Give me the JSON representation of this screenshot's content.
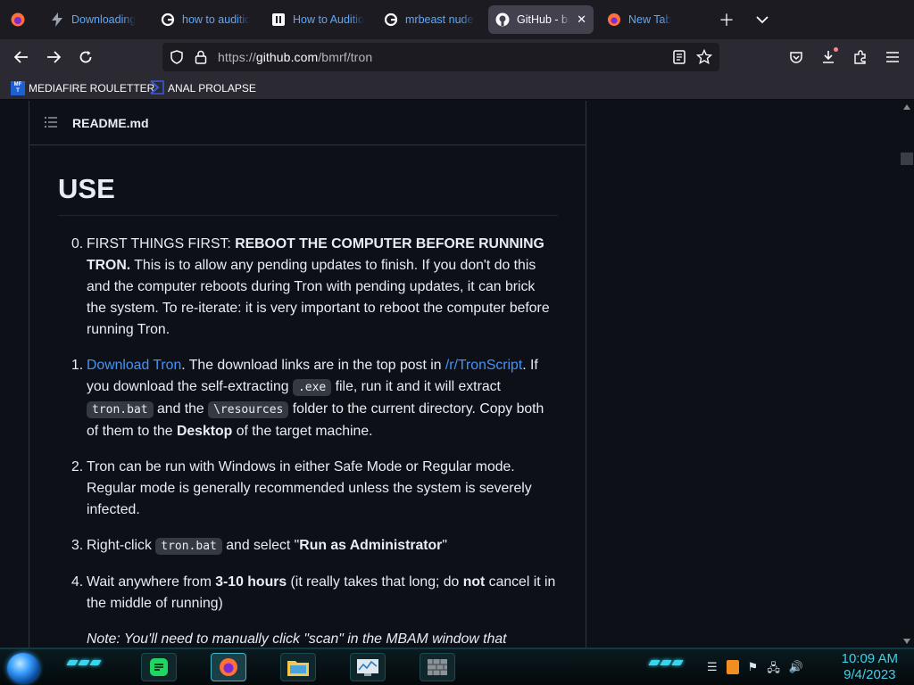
{
  "tabs": [
    {
      "label": "Downloading C",
      "icon": "bolt-icon"
    },
    {
      "label": "how to audition",
      "icon": "google-icon"
    },
    {
      "label": "How to Auditio",
      "icon": "site-icon"
    },
    {
      "label": "mrbeast nudes",
      "icon": "google-icon"
    },
    {
      "label": "GitHub - bmrf",
      "icon": "github-icon",
      "active": true
    },
    {
      "label": "New Tab",
      "icon": "firefox-icon"
    }
  ],
  "url": {
    "scheme": "https://",
    "host": "github.com",
    "path": "/bmrf/tron"
  },
  "bookmarks": [
    {
      "label": "MEDIAFIRE ROULETTER",
      "badge": "MF\nT"
    },
    {
      "label": "ANAL PROLAPSE"
    }
  ],
  "readme": {
    "file_title": "README.md",
    "heading": "USE",
    "steps": [
      {
        "num": "0.",
        "lead": "FIRST THINGS FIRST: ",
        "bold": "REBOOT THE COMPUTER BEFORE RUNNING TRON.",
        "rest": " This is to allow any pending updates to finish. If you don't do this and the computer reboots during Tron with pending updates, it can brick the system. To re-iterate: it is very important to reboot the computer before running Tron."
      },
      {
        "num": "1.",
        "link1": "Download Tron",
        "t1": ". The download links are in the top post in ",
        "link2": "/r/TronScript",
        "t2": ". If you download the self-extracting ",
        "code1": ".exe",
        "t3": " file, run it and it will extract ",
        "code2": "tron.bat",
        "t4": " and the ",
        "code3": "\\resources",
        "t5": " folder to the current directory. Copy both of them to the ",
        "bold1": "Desktop",
        "t6": " of the target machine."
      },
      {
        "num": "2.",
        "text": "Tron can be run with Windows in either Safe Mode or Regular mode. Regular mode is generally recommended unless the system is severely infected."
      },
      {
        "num": "3.",
        "t1": "Right-click ",
        "code1": "tron.bat",
        "t2": " and select \"",
        "bold1": "Run as Administrator",
        "t3": "\""
      },
      {
        "num": "4.",
        "t1": "Wait anywhere from ",
        "bold1": "3-10 hours",
        "t2": " (it really takes that long; do ",
        "bold2": "not",
        "t3": " cancel it in the middle of running)",
        "note": "Note: You'll need to manually click \"scan\" in the MBAM window that appears"
      }
    ]
  },
  "clock": {
    "time": "10:09 AM",
    "date": "9/4/2023"
  },
  "colors": {
    "link": "#4493f8",
    "accent_taskbar": "#36d6ef",
    "tab_link": "#5aa9ff"
  }
}
